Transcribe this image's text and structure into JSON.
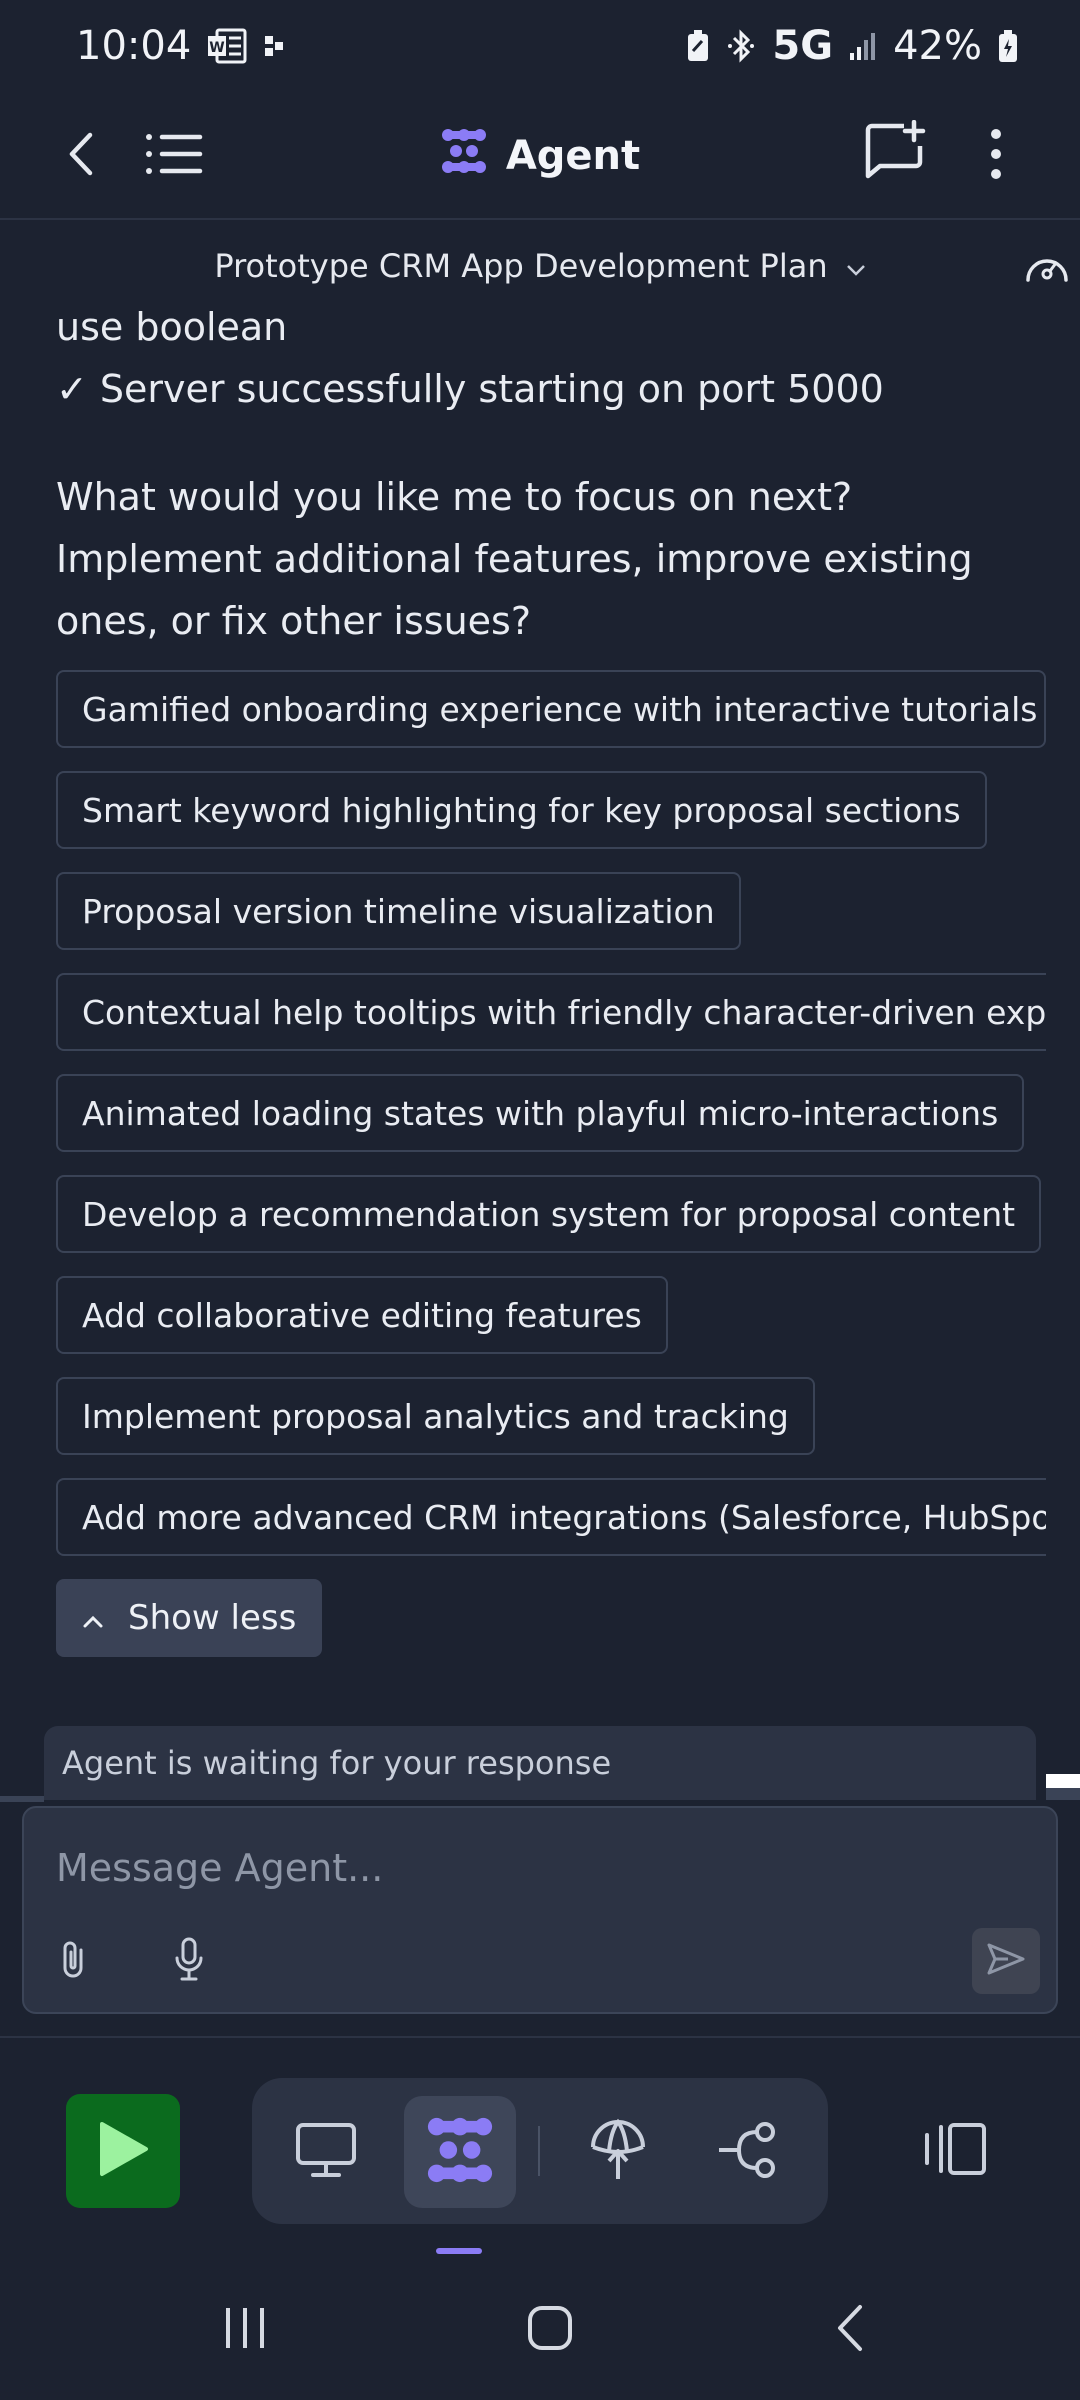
{
  "status_bar": {
    "time": "10:04",
    "network": "5G",
    "battery": "42%"
  },
  "header": {
    "title": "Agent"
  },
  "chat": {
    "title": "Prototype CRM App Development Plan"
  },
  "message": {
    "line1": "use boolean",
    "line2": "✓ Server successfully starting on port 5000",
    "question_l1": "What would you like me to focus on next?",
    "question_l2": "Implement additional features, improve existing",
    "question_l3": "ones, or fix other issues?"
  },
  "suggestions": [
    "Gamified onboarding experience with interactive tutorials",
    "Smart keyword highlighting for key proposal sections",
    "Proposal version timeline visualization",
    "Contextual help tooltips with friendly character-driven explanati",
    "Animated loading states with playful micro-interactions",
    "Develop a recommendation system for proposal content",
    "Add collaborative editing features",
    "Implement proposal analytics and tracking",
    "Add more advanced CRM integrations (Salesforce, HubSpot, etc."
  ],
  "show_less_label": "Show less",
  "waiting_text": "Agent is waiting for your response",
  "composer": {
    "placeholder": "Message Agent..."
  },
  "icons": {
    "status_left": [
      "word-icon",
      "notification-dot-icon"
    ],
    "status_right": [
      "battery-saver-icon",
      "bluetooth-icon",
      "signal-icon",
      "battery-icon"
    ],
    "header": [
      "back-icon",
      "list-icon",
      "agent-logo-icon",
      "new-chat-icon",
      "more-icon"
    ],
    "bottom_toolbar": [
      "play-icon",
      "monitor-icon",
      "agent-icon",
      "deploy-icon",
      "git-icon",
      "panel-icon"
    ]
  },
  "colors": {
    "background": "#1c2230",
    "surface": "#2c3344",
    "accent": "#8b7cf5",
    "run_green": "#0b6b1e",
    "run_icon": "#9cf29f"
  }
}
